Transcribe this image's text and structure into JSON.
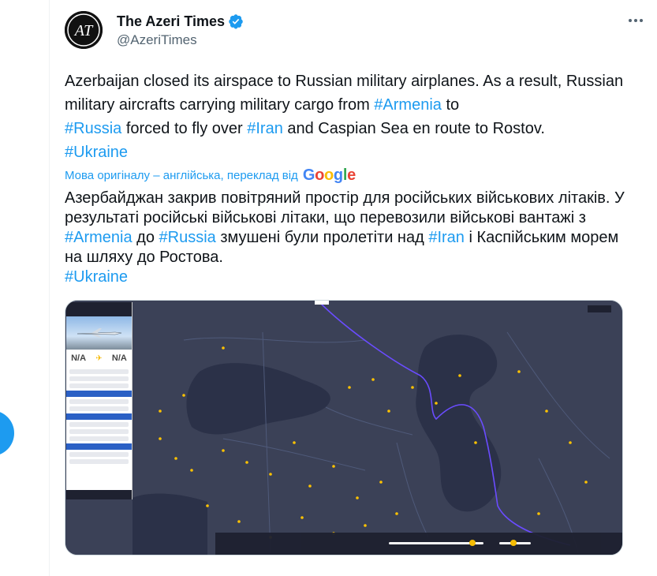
{
  "author": {
    "display_name": "The Azeri Times",
    "handle": "@AzeriTimes",
    "avatar_initials": "AT",
    "verified": true
  },
  "tweet": {
    "en": {
      "p1": "Azerbaijan closed its airspace to Russian military airplanes. As a result, Russian military aircrafts carrying military cargo from ",
      "tag_armenia": "#Armenia",
      "p2": " to ",
      "tag_russia": "#Russia",
      "p3": " forced to fly over ",
      "tag_iran": "#Iran",
      "p4": " and Caspian Sea en route to Rostov.",
      "tag_ukraine": "#Ukraine"
    },
    "translation_note": "Мова оригіналу – англійська, переклад від",
    "translation_provider": "Google",
    "uk": {
      "p1": "Азербайджан закрив повітряний простір для російських військових літаків. У результаті російські військові літаки, що перевозили військові вантажі з ",
      "tag_armenia": "#Armenia",
      "p2": " до ",
      "tag_russia": "#Russia",
      "p3": " змушені були пролетіти над ",
      "tag_iran": "#Iran",
      "p4": " і Каспійським морем на шляху до Ростова.",
      "tag_ukraine": "#Ukraine"
    }
  },
  "media": {
    "flight_panel": {
      "route_from": "N/A",
      "route_to": "N/A"
    }
  },
  "colors": {
    "link": "#1d9bf0",
    "text": "#0f1419",
    "secondary": "#536471",
    "map_land": "#3b4157",
    "map_sea": "#2b3148",
    "accent_yellow": "#ffc300"
  },
  "icons": [
    "verified-badge-icon",
    "more-options-icon",
    "google-logo",
    "plane-icon"
  ]
}
